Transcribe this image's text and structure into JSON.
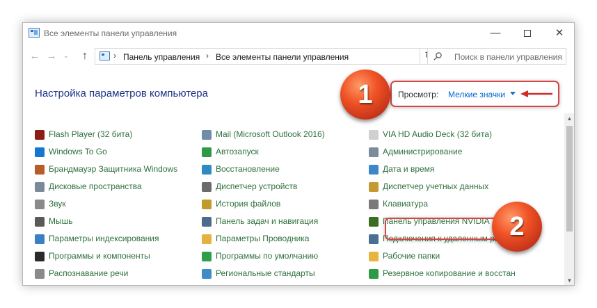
{
  "window": {
    "title": "Все элементы панели управления",
    "minimize_symbol": "—",
    "close_symbol": "✕"
  },
  "nav": {
    "back_symbol": "←",
    "forward_symbol": "→",
    "recent_symbol": "⌄",
    "up_symbol": "↑",
    "address_separator": "›",
    "breadcrumbs": [
      "Панель управления",
      "Все элементы панели управления"
    ],
    "address_dropdown_symbol": "⌄",
    "refresh_symbol": "↻",
    "search_placeholder": "Поиск в панели управления"
  },
  "header": {
    "title": "Настройка параметров компьютера",
    "view_label": "Просмотр:",
    "view_value": "Мелкие значки"
  },
  "callouts": {
    "first": "1",
    "second": "2"
  },
  "items": {
    "column1": [
      {
        "label": "Flash Player (32 бита)",
        "icon": "flash-icon",
        "color": "#8b1d12"
      },
      {
        "label": "Windows To Go",
        "icon": "windows-to-go-icon",
        "color": "#1677d2"
      },
      {
        "label": "Брандмауэр Защитника Windows",
        "icon": "firewall-icon",
        "color": "#b85c2a"
      },
      {
        "label": "Дисковые пространства",
        "icon": "storage-spaces-icon",
        "color": "#7a8a99"
      },
      {
        "label": "Звук",
        "icon": "sound-icon",
        "color": "#8a8a8a"
      },
      {
        "label": "Мышь",
        "icon": "mouse-icon",
        "color": "#5a5a5a"
      },
      {
        "label": "Параметры индексирования",
        "icon": "indexing-icon",
        "color": "#3d7fc4"
      },
      {
        "label": "Программы и компоненты",
        "icon": "programs-icon",
        "color": "#2a2a2a"
      },
      {
        "label": "Распознавание речи",
        "icon": "speech-icon",
        "color": "#8a8a8a"
      }
    ],
    "column2": [
      {
        "label": "Mail (Microsoft Outlook 2016)",
        "icon": "mail-icon",
        "color": "#6f8da8"
      },
      {
        "label": "Автозапуск",
        "icon": "autoplay-icon",
        "color": "#2f9a46"
      },
      {
        "label": "Восстановление",
        "icon": "recovery-icon",
        "color": "#2f8ac4"
      },
      {
        "label": "Диспетчер устройств",
        "icon": "device-manager-icon",
        "color": "#6b6b6b"
      },
      {
        "label": "История файлов",
        "icon": "file-history-icon",
        "color": "#c09a2a"
      },
      {
        "label": "Панель задач и навигация",
        "icon": "taskbar-icon",
        "color": "#4d6b8a"
      },
      {
        "label": "Параметры Проводника",
        "icon": "explorer-options-icon",
        "color": "#e3b340"
      },
      {
        "label": "Программы по умолчанию",
        "icon": "default-programs-icon",
        "color": "#2e9e4a"
      },
      {
        "label": "Региональные стандарты",
        "icon": "region-icon",
        "color": "#3f8cc8"
      }
    ],
    "column3": [
      {
        "label": "VIA HD Audio Deck (32 бита)",
        "icon": "audio-deck-icon",
        "color": "#d0d0d0"
      },
      {
        "label": "Администрирование",
        "icon": "admin-tools-icon",
        "color": "#7d8c99"
      },
      {
        "label": "Дата и время",
        "icon": "date-time-icon",
        "color": "#3c86c9"
      },
      {
        "label": "Диспетчер учетных данных",
        "icon": "credential-manager-icon",
        "color": "#c49a35"
      },
      {
        "label": "Клавиатура",
        "icon": "keyboard-icon",
        "color": "#7a7a7a"
      },
      {
        "label": "Панель управления NVIDIA",
        "icon": "nvidia-icon",
        "color": "#3a6e20"
      },
      {
        "label": "Подключения к удаленным ра",
        "icon": "remote-app-icon",
        "color": "#4a6f93"
      },
      {
        "label": "Рабочие папки",
        "icon": "work-folders-icon",
        "color": "#e6b53d"
      },
      {
        "label": "Резервное копирование и восстан",
        "icon": "backup-icon",
        "color": "#2f9a46"
      }
    ]
  },
  "scrollbar": {
    "up_symbol": "▲",
    "down_symbol": "▼"
  }
}
